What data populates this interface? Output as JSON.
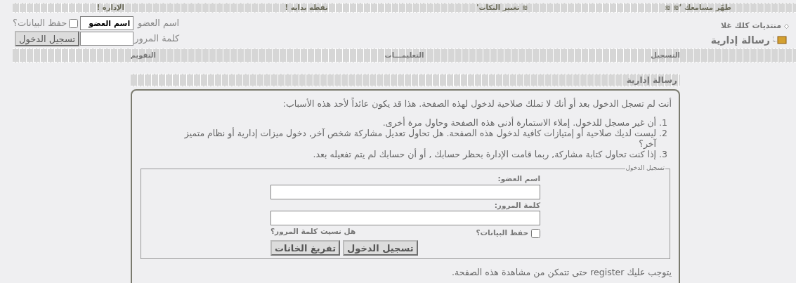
{
  "top_links": [
    {
      "label": "طهّر مسامعك ’≋ ≋"
    },
    {
      "label": "≋ تغيير النكات'"
    },
    {
      "label": "نقطه بدايه !"
    },
    {
      "label": "الإدارة !"
    }
  ],
  "site": {
    "forum_name": "منتديات كلك غلا",
    "page_title": "رسالة إدارية"
  },
  "quick_login": {
    "username_label": "اسم العضو",
    "username_value": "اسم العضو",
    "remember_label": "حفظ البيانات؟",
    "remember_checked": false,
    "password_label": "كلمة المرور",
    "button": "تسجيل الدخول"
  },
  "nav": [
    {
      "label": "التسجيل"
    },
    {
      "label": "التعليمـــات"
    },
    {
      "label": "التقويم"
    }
  ],
  "message": {
    "title": "رسالة إدارية",
    "intro": "أنت لم تسجل الدخول بعد أو أنك لا تملك صلاحية لدخول لهذه الصفحة. هذا قد يكون عائداً لأحد هذه الأسباب:",
    "reasons": [
      {
        "number": "1.",
        "text": "أن غير مسجل للدخول. إملاء الاستمارة أدنى هذه الصفحة وحاول مرة أخرى."
      },
      {
        "number": "2.",
        "text": "ليست لديك صلاحية أو إمتيازات كافية لدخول هذه الصفحة. هل تحاول تعديل مشاركة شخص آخر, دخول ميزات إدارية أو نظام متميز آخر؟"
      },
      {
        "number": "3.",
        "text": "إذا كنت تحاول كتابة مشاركة, ربما قامت الإدارة بحظر حسابك , أو أن حسابك لم يتم تفعيله بعد."
      }
    ],
    "login_box": {
      "legend": "تسجيل الدخول",
      "username_label": "اسم العضو:",
      "password_label": "كلمة المرور:",
      "forgot_link": "هل نسيت كلمة المرور؟",
      "remember_label": "حفظ البيانات؟",
      "remember_checked": false,
      "buttons": [
        "تسجيل الدخول",
        "تفريغ الخانات"
      ]
    },
    "footer": "يتوجب عليك register حتى تتمكن من مشاهدة هذه الصفحة."
  }
}
